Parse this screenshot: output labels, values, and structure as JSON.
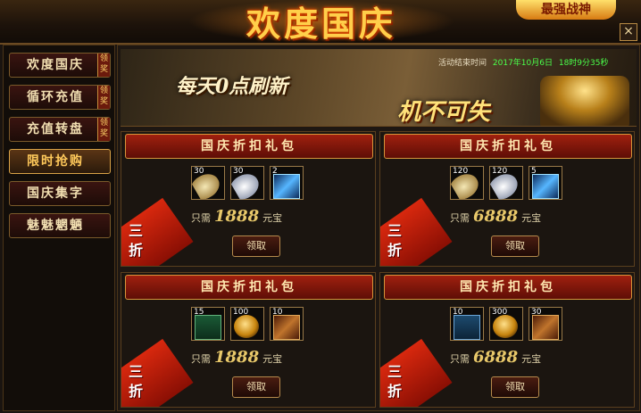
{
  "event_title": "欢度国庆",
  "corner_badge": "最强战神",
  "close_label": "×",
  "sidebar": {
    "items": [
      {
        "label": "欢度国庆",
        "tag": "领奖"
      },
      {
        "label": "循环充值",
        "tag": "领奖"
      },
      {
        "label": "充值转盘",
        "tag": "领奖"
      },
      {
        "label": "限时抢购",
        "tag": ""
      },
      {
        "label": "国庆集字",
        "tag": ""
      },
      {
        "label": "魅魅魍魉",
        "tag": ""
      }
    ],
    "active_index": 3
  },
  "hero": {
    "slogan_left": "每天0点刷新",
    "slogan_right": "机不可失",
    "timer_label": "活动结束时间",
    "timer_date": "2017年10月6日",
    "timer_remaining": "18时9分35秒"
  },
  "packs": [
    {
      "title": "国庆折扣礼包",
      "items": [
        {
          "count": "30",
          "icon": "gold-feather-icon"
        },
        {
          "count": "30",
          "icon": "white-feather-icon"
        },
        {
          "count": "2",
          "icon": "blue-wing-icon"
        }
      ],
      "price_prefix": "只需",
      "price": "1888",
      "currency": "元宝",
      "discount": "三折",
      "button": "领取"
    },
    {
      "title": "国庆折扣礼包",
      "items": [
        {
          "count": "120",
          "icon": "gold-feather-icon"
        },
        {
          "count": "120",
          "icon": "white-feather-icon"
        },
        {
          "count": "5",
          "icon": "blue-wing-icon"
        }
      ],
      "price_prefix": "只需",
      "price": "6888",
      "currency": "元宝",
      "discount": "三折",
      "button": "领取"
    },
    {
      "title": "国庆折扣礼包",
      "items": [
        {
          "count": "15",
          "icon": "green-book-icon"
        },
        {
          "count": "100",
          "icon": "gold-egg-icon"
        },
        {
          "count": "10",
          "icon": "scroll-icon"
        }
      ],
      "price_prefix": "只需",
      "price": "1888",
      "currency": "元宝",
      "discount": "三折",
      "button": "领取"
    },
    {
      "title": "国庆折扣礼包",
      "items": [
        {
          "count": "10",
          "icon": "blue-book-icon"
        },
        {
          "count": "300",
          "icon": "gold-egg-icon"
        },
        {
          "count": "30",
          "icon": "scroll-icon"
        }
      ],
      "price_prefix": "只需",
      "price": "6888",
      "currency": "元宝",
      "discount": "三折",
      "button": "领取"
    }
  ]
}
